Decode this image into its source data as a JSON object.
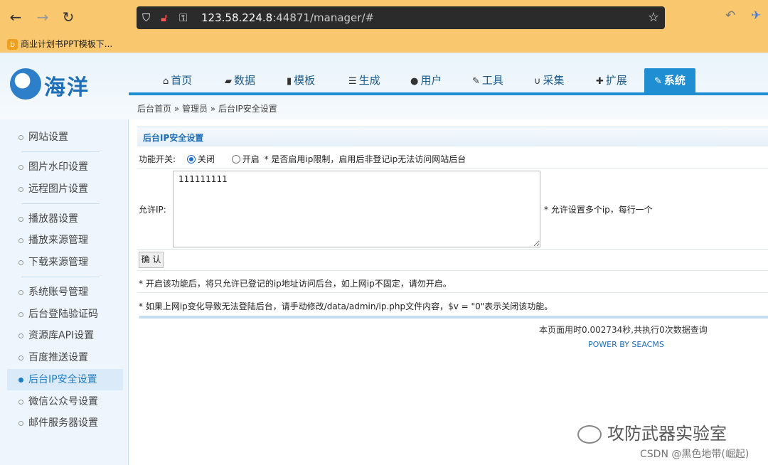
{
  "browser": {
    "url_host": "123.58.224.8",
    "url_port_path": ":44871/manager/#",
    "bookmark": "商业计划书PPT模板下..."
  },
  "header": {
    "logo_text": "海洋",
    "tabs": [
      {
        "label": "首页",
        "icon": "home-icon"
      },
      {
        "label": "数据",
        "icon": "book-icon"
      },
      {
        "label": "模板",
        "icon": "file-icon"
      },
      {
        "label": "生成",
        "icon": "server-icon"
      },
      {
        "label": "用户",
        "icon": "user-icon"
      },
      {
        "label": "工具",
        "icon": "wrench-icon"
      },
      {
        "label": "采集",
        "icon": "magnet-icon"
      },
      {
        "label": "扩展",
        "icon": "puzzle-icon"
      },
      {
        "label": "系统",
        "icon": "edit-icon",
        "active": true
      }
    ],
    "breadcrumb": "后台首页 » 管理员 » 后台IP安全设置"
  },
  "sidebar": {
    "items": [
      "网站设置",
      "图片水印设置",
      "远程图片设置",
      "播放器设置",
      "播放来源管理",
      "下载来源管理",
      "系统账号管理",
      "后台登陆验证码",
      "资源库API设置",
      "百度推送设置",
      "后台IP安全设置",
      "微信公众号设置",
      "邮件服务器设置"
    ],
    "active_index": 10
  },
  "main": {
    "title": "后台IP安全设置",
    "switch_label": "功能开关:",
    "option_off": "关闭",
    "option_on": "开启",
    "switch_hint": "* 是否启用ip限制，启用后非登记ip无法访问网站后台",
    "allow_label": "允许IP:",
    "ip_value": "111111111",
    "allow_hint": "* 允许设置多个ip，每行一个",
    "confirm_label": "确 认",
    "note1": "* 开启该功能后，将只允许已登记的ip地址访问后台，如上网ip不固定，请勿开启。",
    "note2": "* 如果上网ip变化导致无法登陆后台，请手动修改/data/admin/ip.php文件内容，$v = \"0\"表示关闭该功能。"
  },
  "footer": {
    "timing": "本页面用时0.002734秒,共执行0次数据查询",
    "powered": "POWER BY SEACMS"
  },
  "watermark": {
    "text": "攻防武器实验室",
    "csdn": "CSDN @黑色地带(崛起)"
  }
}
